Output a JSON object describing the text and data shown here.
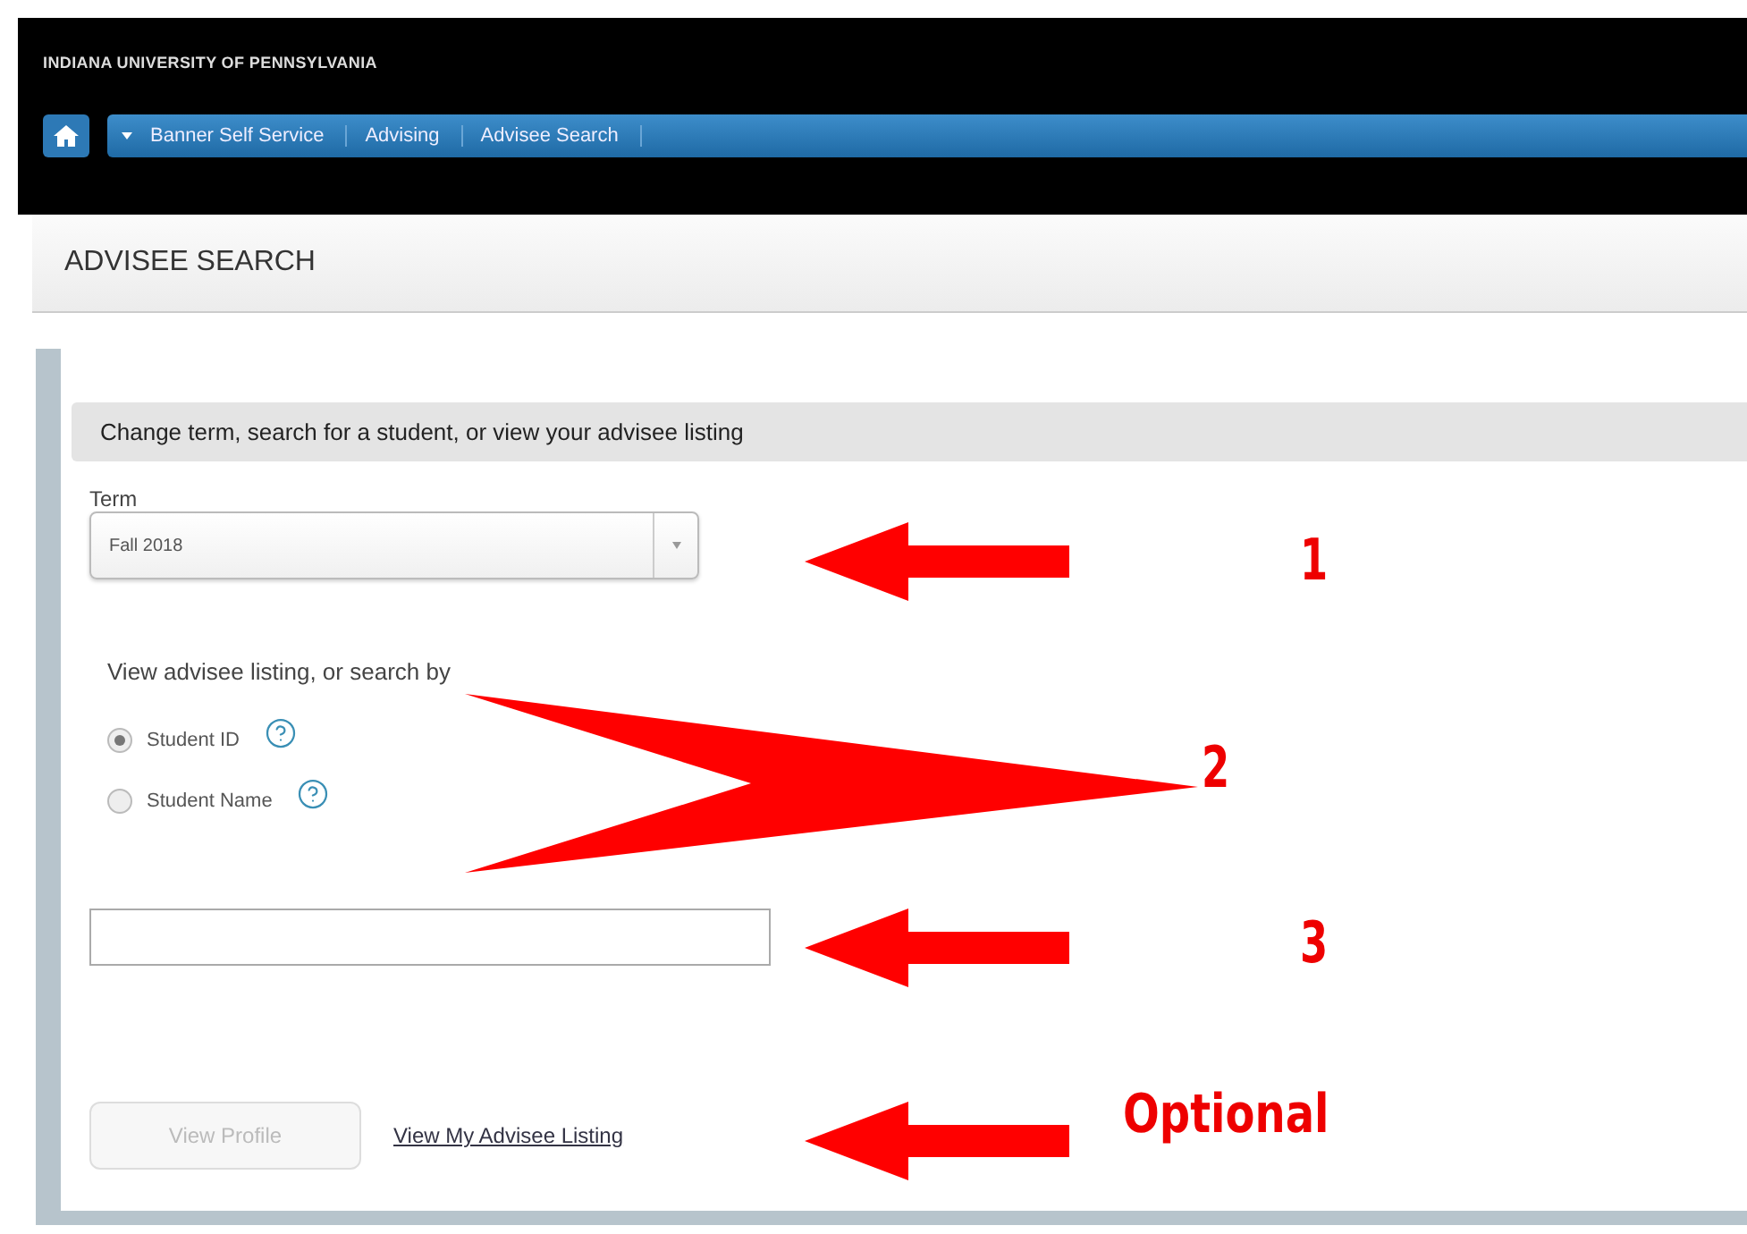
{
  "header": {
    "title": "INDIANA UNIVERSITY OF PENNSYLVANIA"
  },
  "breadcrumbs": [
    {
      "label": "Banner Self Service"
    },
    {
      "label": "Advising"
    },
    {
      "label": "Advisee Search"
    }
  ],
  "page_title": "ADVISEE SEARCH",
  "section_title": "Change term, search for a student, or view your advisee listing",
  "term": {
    "label": "Term",
    "value": "Fall 2018"
  },
  "search_by": {
    "label": "View advisee listing, or search by",
    "options": [
      {
        "label": "Student ID",
        "selected": true
      },
      {
        "label": "Student Name",
        "selected": false
      }
    ]
  },
  "view_profile_button": {
    "label": "View Profile",
    "disabled": true
  },
  "listing_link": {
    "label": "View My Advisee Listing"
  },
  "annotations": [
    {
      "kind": "arrow",
      "label": "1"
    },
    {
      "kind": "wedge",
      "label": "2"
    },
    {
      "kind": "arrow",
      "label": "3"
    },
    {
      "kind": "arrow",
      "label": "Optional"
    }
  ]
}
